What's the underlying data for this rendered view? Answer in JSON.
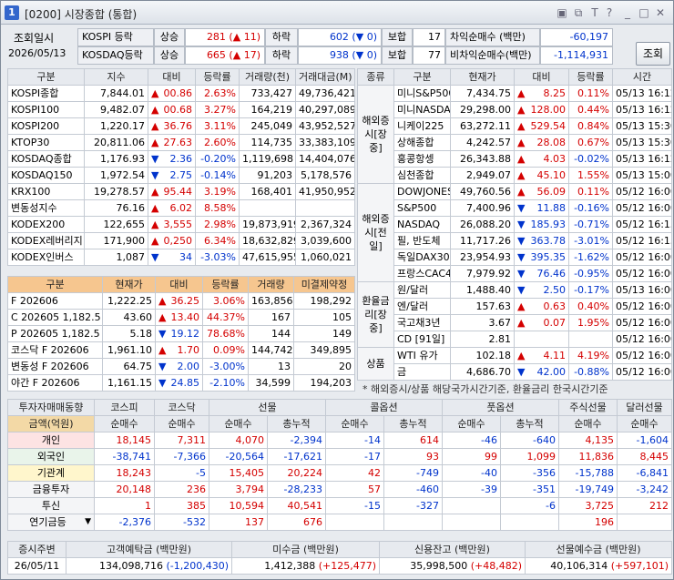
{
  "window": {
    "num": "1",
    "title": "[0200] 시장종합 (통합)"
  },
  "top": {
    "lookup_label": "조회일시",
    "date": "2026/05/13",
    "lookup_button": "조회",
    "rows": [
      {
        "name": "KOSPI 등락",
        "up_label": "상승",
        "up": "281",
        "up_arrow": "▲",
        "up_chg": "11",
        "down_label": "하락",
        "down": "602",
        "down_arrow": "▼",
        "down_chg": "0",
        "flat_label": "보합",
        "flat": "17",
        "net_label": "차익순매수 (백만)",
        "net": "-60,197"
      },
      {
        "name": "KOSDAQ등락",
        "up_label": "상승",
        "up": "665",
        "up_arrow": "▲",
        "up_chg": "17",
        "down_label": "하락",
        "down": "938",
        "down_arrow": "▼",
        "down_chg": "0",
        "flat_label": "보합",
        "flat": "77",
        "net_label": "비차익순매수(백만)",
        "net": "-1,114,931"
      }
    ]
  },
  "index": {
    "headers": [
      "구분",
      "지수",
      "대비",
      "등락률",
      "거래량(천)",
      "거래대금(M)"
    ],
    "rows": [
      {
        "name": "KOSPI종합",
        "value": "7,844.01",
        "dir": "up",
        "chg": "00.86",
        "rate": "2.63%",
        "vol": "733,427",
        "amt": "49,736,421"
      },
      {
        "name": "KOSPI100",
        "value": "9,482.07",
        "dir": "up",
        "chg": "00.68",
        "rate": "3.27%",
        "vol": "164,219",
        "amt": "40,297,089"
      },
      {
        "name": "KOSPI200",
        "value": "1,220.17",
        "dir": "up",
        "chg": "36.76",
        "rate": "3.11%",
        "vol": "245,049",
        "amt": "43,952,527"
      },
      {
        "name": "KTOP30",
        "value": "20,811.06",
        "dir": "up",
        "chg": "27.63",
        "rate": "2.60%",
        "vol": "114,735",
        "amt": "33,383,109"
      },
      {
        "name": "KOSDAQ종합",
        "value": "1,176.93",
        "dir": "down",
        "chg": "2.36",
        "rate": "-0.20%",
        "vol": "1,119,698",
        "amt": "14,404,076"
      },
      {
        "name": "KOSDAQ150",
        "value": "1,972.54",
        "dir": "down",
        "chg": "2.75",
        "rate": "-0.14%",
        "vol": "91,203",
        "amt": "5,178,576"
      },
      {
        "name": "KRX100",
        "value": "19,278.57",
        "dir": "up",
        "chg": "95.44",
        "rate": "3.19%",
        "vol": "168,401",
        "amt": "41,950,952"
      },
      {
        "name": "변동성지수",
        "value": "76.16",
        "dir": "up",
        "chg": "6.02",
        "rate": "8.58%",
        "vol": "",
        "amt": ""
      },
      {
        "name": "KODEX200",
        "value": "122,655",
        "dir": "up",
        "chg": "3,555",
        "rate": "2.98%",
        "vol": "19,873,919",
        "amt": "2,367,324"
      },
      {
        "name": "KODEX레버리지",
        "value": "171,900",
        "dir": "up",
        "chg": "0,250",
        "rate": "6.34%",
        "vol": "18,632,829",
        "amt": "3,039,600"
      },
      {
        "name": "KODEX인버스",
        "value": "1,087",
        "dir": "down",
        "chg": "34",
        "rate": "-3.03%",
        "vol": "47,615,955",
        "amt": "1,060,021"
      }
    ]
  },
  "futures": {
    "headers": [
      "구분",
      "현재가",
      "대비",
      "등락률",
      "거래량",
      "미결제약정"
    ],
    "rows": [
      {
        "name": "F 202606",
        "value": "1,222.25",
        "dir": "up",
        "chg": "36.25",
        "rate": "3.06%",
        "vol": "163,856",
        "oi": "198,292"
      },
      {
        "name": "C 202605 1,182.5",
        "value": "43.60",
        "dir": "up",
        "chg": "13.40",
        "rate": "44.37%",
        "vol": "167",
        "oi": "105"
      },
      {
        "name": "P 202605 1,182.5",
        "value": "5.18",
        "dir": "down",
        "chg": "19.12",
        "rate": "78.68%",
        "vol": "144",
        "oi": "149"
      },
      {
        "name": "코스닥 F 202606",
        "value": "1,961.10",
        "dir": "up",
        "chg": "1.70",
        "rate": "0.09%",
        "vol": "144,742",
        "oi": "349,895"
      },
      {
        "name": "변동성 F 202606",
        "value": "64.75",
        "dir": "down",
        "chg": "2.00",
        "rate": "-3.00%",
        "vol": "13",
        "oi": "20"
      },
      {
        "name": "야간 F 202606",
        "value": "1,161.15",
        "dir": "down",
        "chg": "24.85",
        "rate": "-2.10%",
        "vol": "34,599",
        "oi": "194,203"
      }
    ]
  },
  "overseas": {
    "headers": [
      "종류",
      "구분",
      "현재가",
      "대비",
      "등락률",
      "시간"
    ],
    "groups": [
      {
        "label": "해외증시[장중]",
        "rows": [
          {
            "name": "미니S&P500",
            "value": "7,434.75",
            "dir": "up",
            "chg": "8.25",
            "rate": "0.11%",
            "time": "05/13 16:12"
          },
          {
            "name": "미니NASDAQ",
            "value": "29,298.00",
            "dir": "up",
            "chg": "128.00",
            "rate": "0.44%",
            "time": "05/13 16:12"
          },
          {
            "name": "니케이225",
            "value": "63,272.11",
            "dir": "up",
            "chg": "529.54",
            "rate": "0.84%",
            "time": "05/13 15:30"
          },
          {
            "name": "상해종합",
            "value": "4,242.57",
            "dir": "up",
            "chg": "28.08",
            "rate": "0.67%",
            "time": "05/13 15:30"
          },
          {
            "name": "홍콩항셍",
            "value": "26,343.88",
            "dir": "up",
            "chg": "4.03",
            "rate": "-0.02%",
            "time": "05/13 16:12"
          },
          {
            "name": "심천종합",
            "value": "2,949.07",
            "dir": "up",
            "chg": "45.10",
            "rate": "1.55%",
            "time": "05/13 15:00"
          }
        ]
      },
      {
        "label": "해외증시[전일]",
        "rows": [
          {
            "name": "DOWJONES",
            "value": "49,760.56",
            "dir": "up",
            "chg": "56.09",
            "rate": "0.11%",
            "time": "05/12 16:00"
          },
          {
            "name": "S&P500",
            "value": "7,400.96",
            "dir": "down",
            "chg": "11.88",
            "rate": "-0.16%",
            "time": "05/12 16:00"
          },
          {
            "name": "NASDAQ",
            "value": "26,088.20",
            "dir": "down",
            "chg": "185.93",
            "rate": "-0.71%",
            "time": "05/12 16:15"
          },
          {
            "name": "필, 반도체",
            "value": "11,717.26",
            "dir": "down",
            "chg": "363.78",
            "rate": "-3.01%",
            "time": "05/12 16:15"
          },
          {
            "name": "독일DAX30",
            "value": "23,954.93",
            "dir": "down",
            "chg": "395.35",
            "rate": "-1.62%",
            "time": "05/12 16:00"
          },
          {
            "name": "프랑스CAC40",
            "value": "7,979.92",
            "dir": "down",
            "chg": "76.46",
            "rate": "-0.95%",
            "time": "05/12 16:00"
          }
        ]
      },
      {
        "label": "환율금리[장중]",
        "rows": [
          {
            "name": "원/달러",
            "value": "1,488.40",
            "dir": "down",
            "chg": "2.50",
            "rate": "-0.17%",
            "time": "05/13 16:00"
          },
          {
            "name": "엔/달러",
            "value": "157.63",
            "dir": "up",
            "chg": "0.63",
            "rate": "0.40%",
            "time": "05/12 16:00"
          },
          {
            "name": "국고채3년",
            "value": "3.67",
            "dir": "up",
            "chg": "0.07",
            "rate": "1.95%",
            "time": "05/12 16:00"
          },
          {
            "name": "CD [91일]",
            "value": "2.81",
            "dir": "",
            "chg": "",
            "rate": "",
            "time": "05/12 16:00"
          }
        ]
      },
      {
        "label": "상품",
        "rows": [
          {
            "name": "WTI 유가",
            "value": "102.18",
            "dir": "up",
            "chg": "4.11",
            "rate": "4.19%",
            "time": "05/12 16:00"
          },
          {
            "name": "금",
            "value": "4,686.70",
            "dir": "down",
            "chg": "42.00",
            "rate": "-0.88%",
            "time": "05/12 16:00"
          }
        ]
      }
    ],
    "note": "* 해외증시/상품 해당국가시간기준, 환율금리 한국시간기준"
  },
  "investors": {
    "top_headers": [
      "투자자매매동향",
      "코스피",
      "코스닥",
      "선물",
      "콜옵션",
      "풋옵션",
      "주식선물",
      "달러선물"
    ],
    "sub_headers": [
      "금액(억원)",
      "순매수",
      "순매수",
      "순매수",
      "총누적",
      "순매수",
      "총누적",
      "순매수",
      "총누적",
      "순매수",
      "순매수"
    ],
    "rows": [
      {
        "name": "개인",
        "vals": [
          "18,145",
          "7,311",
          "4,070",
          "-2,394",
          "-14",
          "614",
          "-46",
          "-640",
          "4,135",
          "-1,604"
        ]
      },
      {
        "name": "외국인",
        "vals": [
          "-38,741",
          "-7,366",
          "-20,564",
          "-17,621",
          "-17",
          "93",
          "99",
          "1,099",
          "11,836",
          "8,445"
        ]
      },
      {
        "name": "기관계",
        "vals": [
          "18,243",
          "-5",
          "15,405",
          "20,224",
          "42",
          "-749",
          "-40",
          "-356",
          "-15,788",
          "-6,841"
        ]
      },
      {
        "name": "금융투자",
        "vals": [
          "20,148",
          "236",
          "3,794",
          "-28,233",
          "57",
          "-460",
          "-39",
          "-351",
          "-19,749",
          "-3,242"
        ]
      },
      {
        "name": "투신",
        "vals": [
          "1",
          "385",
          "10,594",
          "40,541",
          "-15",
          "-327",
          "",
          "-6",
          "3,725",
          "212"
        ]
      },
      {
        "name": "연기금등",
        "vals": [
          "-2,376",
          "-532",
          "137",
          "676",
          "",
          "",
          "",
          "",
          "196",
          ""
        ]
      }
    ]
  },
  "bottom": {
    "headers": [
      "증시주변",
      "고객예탁금 (백만원)",
      "미수금 (백만원)",
      "신용잔고 (백만원)",
      "선물예수금 (백만원)"
    ],
    "date": "26/05/11",
    "deposit": "134,098,716",
    "deposit_chg": "(-1,200,430)",
    "unpaid": "1,412,388",
    "unpaid_chg": "(+125,477)",
    "credit": "35,998,500",
    "credit_chg": "(+48,482)",
    "fut_deposit": "40,106,314",
    "fut_deposit_chg": "(+597,101)"
  }
}
